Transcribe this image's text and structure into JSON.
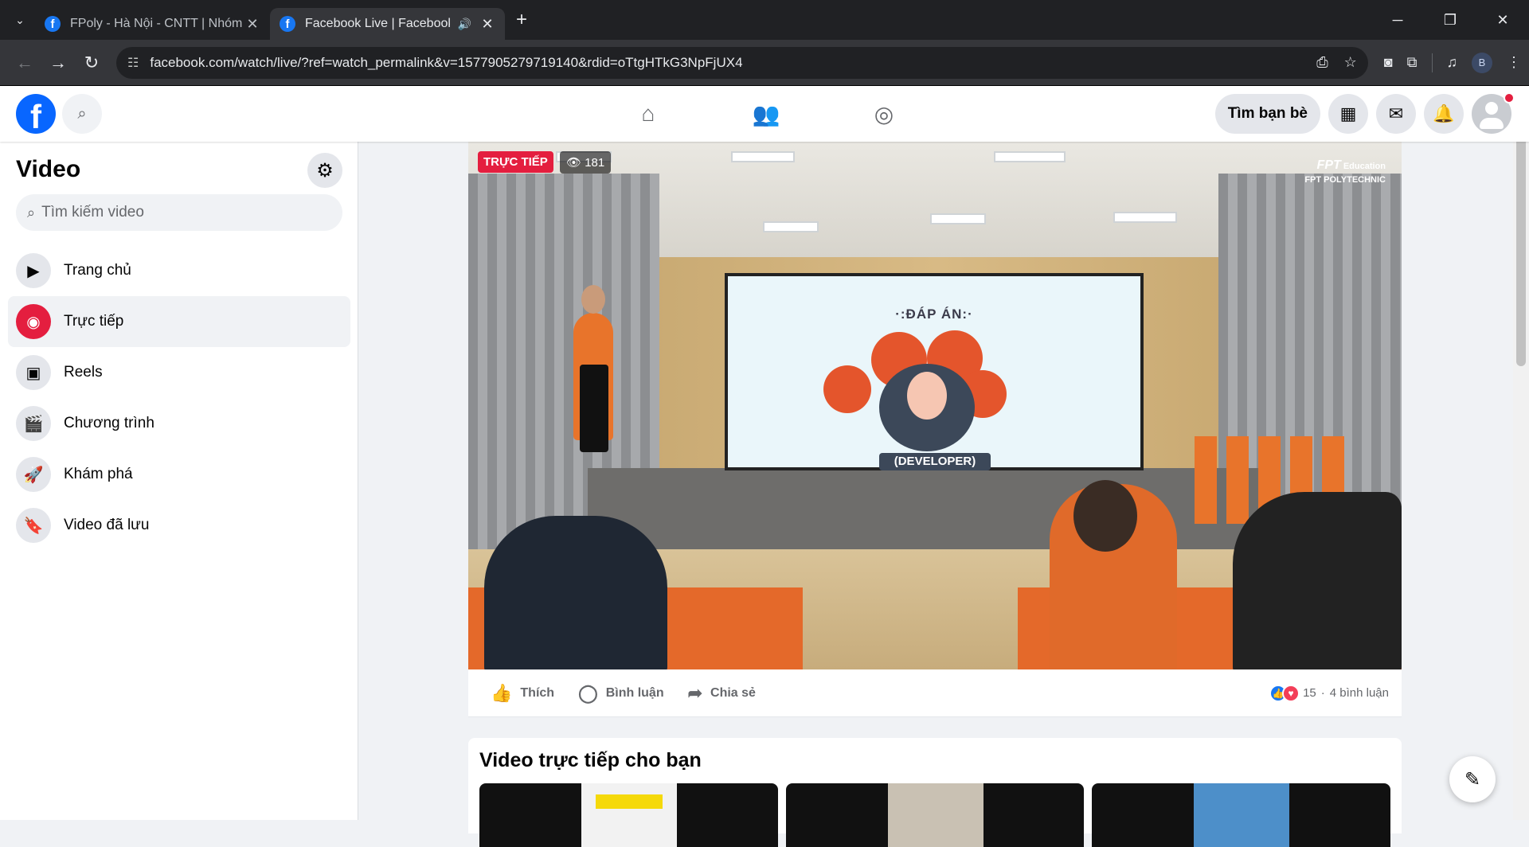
{
  "browser": {
    "tabs": [
      {
        "title": "FPoly - Hà Nội - CNTT | Nhóm |",
        "active": false
      },
      {
        "title": "Facebook Live | Facebook",
        "active": true
      }
    ],
    "url": "facebook.com/watch/live/?ref=watch_permalink&v=1577905279719140&rdid=oTtgHTkG3NpFjUX4",
    "profile_initial": "B"
  },
  "fb_header": {
    "find_friends": "Tìm bạn bè"
  },
  "sidebar": {
    "title": "Video",
    "search_placeholder": "Tìm kiếm video",
    "items": [
      {
        "label": "Trang chủ",
        "icon": "play-icon"
      },
      {
        "label": "Trực tiếp",
        "icon": "live-camera-icon",
        "active": true
      },
      {
        "label": "Reels",
        "icon": "reels-icon"
      },
      {
        "label": "Chương trình",
        "icon": "clapper-icon"
      },
      {
        "label": "Khám phá",
        "icon": "rocket-icon"
      },
      {
        "label": "Video đã lưu",
        "icon": "bookmark-icon"
      }
    ]
  },
  "video": {
    "live_badge": "TRỰC TIẾP",
    "viewers": "181",
    "watermark_brand": "FPT",
    "watermark_sub": "Education",
    "watermark_school": "FPT POLYTECHNIC",
    "screen_title": "·:ĐÁP ÁN:·",
    "screen_label": "(DEVELOPER)"
  },
  "actions": {
    "like": "Thích",
    "comment": "Bình luận",
    "share": "Chia sẻ",
    "reaction_count": "15",
    "comment_count": "4 bình luận"
  },
  "live_for_you": {
    "heading": "Video trực tiếp cho bạn"
  },
  "colors": {
    "facebook_blue": "#0866ff",
    "live_red": "#e41e3f",
    "browser_dark": "#202124"
  }
}
